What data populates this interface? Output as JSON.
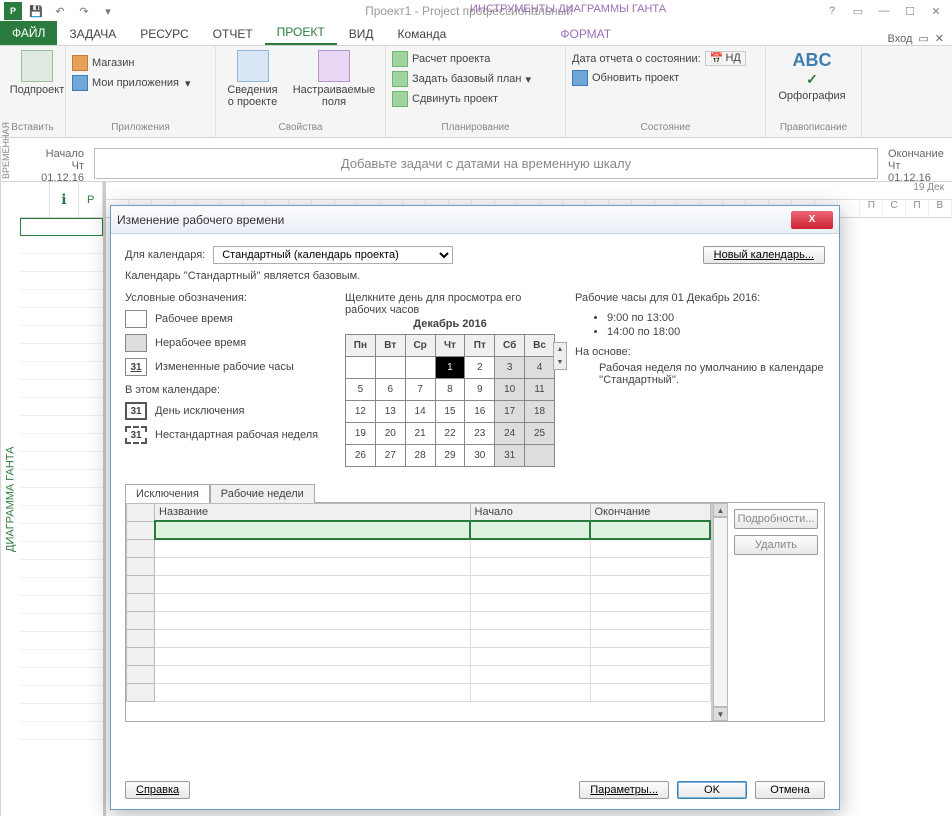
{
  "titlebar": {
    "app_title": "Проект1 - Project профессиональный",
    "tools_title": "ИНСТРУМЕНТЫ ДИАГРАММЫ ГАНТА"
  },
  "tabs": {
    "file": "ФАЙЛ",
    "task": "ЗАДАЧА",
    "resource": "РЕСУРС",
    "report": "ОТЧЕТ",
    "project": "ПРОЕКТ",
    "view": "ВИД",
    "team": "Команда",
    "format": "ФОРМАТ",
    "login": "Вход"
  },
  "ribbon": {
    "insert": {
      "subproject": "Подпроект",
      "label": "Вставить"
    },
    "apps": {
      "store": "Магазин",
      "myapps": "Мои приложения",
      "label": "Приложения"
    },
    "props": {
      "info": "Сведения\nо проекте",
      "fields": "Настраиваемые\nполя",
      "label": "Свойства"
    },
    "plan": {
      "calc": "Расчет проекта",
      "baseline": "Задать базовый план",
      "move": "Сдвинуть проект",
      "label": "Планирование"
    },
    "state": {
      "date_lbl": "Дата отчета о состоянии:",
      "nd": "НД",
      "update": "Обновить проект",
      "label": "Состояние"
    },
    "spell": {
      "spell": "Орфография",
      "label": "Правописание"
    }
  },
  "timeline": {
    "start_lbl": "Начало",
    "start_date": "Чт 01.12.16",
    "end_lbl": "Окончание",
    "end_date": "Чт 01.12.16",
    "hint": "Добавьте задачи с датами на временную шкалу",
    "side": "ВРЕМЕННАЯ"
  },
  "gantt": {
    "side": "ДИАГРАММА ГАНТА",
    "top_right": "19 Дек",
    "days": [
      "П",
      "С",
      "П",
      "В"
    ]
  },
  "dialog": {
    "title": "Изменение рабочего времени",
    "cal_for": "Для календаря:",
    "cal_select": "Стандартный (календарь проекта)",
    "new_cal": "Новый календарь...",
    "base_text": "Календарь ''Стандартный'' является базовым.",
    "legend_title": "Условные обозначения:",
    "legend": {
      "work": "Рабочее время",
      "nonwork": "Нерабочее время",
      "changed": "Измененные рабочие часы",
      "in_cal": "В этом календаре:",
      "exc_day": "День исключения",
      "nonstd": "Нестандартная рабочая неделя",
      "n31": "31"
    },
    "cal": {
      "click": "Щелкните день для просмотра его рабочих часов",
      "month": "Декабрь 2016",
      "dh": [
        "Пн",
        "Вт",
        "Ср",
        "Чт",
        "Пт",
        "Сб",
        "Вс"
      ],
      "weeks": [
        [
          "",
          "",
          "",
          "1",
          "2",
          "3",
          "4"
        ],
        [
          "5",
          "6",
          "7",
          "8",
          "9",
          "10",
          "11"
        ],
        [
          "12",
          "13",
          "14",
          "15",
          "16",
          "17",
          "18"
        ],
        [
          "19",
          "20",
          "21",
          "22",
          "23",
          "24",
          "25"
        ],
        [
          "26",
          "27",
          "28",
          "29",
          "30",
          "31",
          ""
        ]
      ]
    },
    "hours": {
      "title": "Рабочие часы для 01 Декабрь 2016:",
      "h1": "9:00 по 13:00",
      "h2": "14:00 по 18:00",
      "based": "На основе:",
      "text": "Рабочая неделя по умолчанию в календаре ''Стандартный''."
    },
    "exc": {
      "tab1": "Исключения",
      "tab2": "Рабочие недели",
      "col_name": "Название",
      "col_start": "Начало",
      "col_end": "Окончание",
      "details": "Подробности...",
      "delete": "Удалить"
    },
    "footer": {
      "help": "Справка",
      "params": "Параметры...",
      "ok": "OK",
      "cancel": "Отмена"
    }
  }
}
